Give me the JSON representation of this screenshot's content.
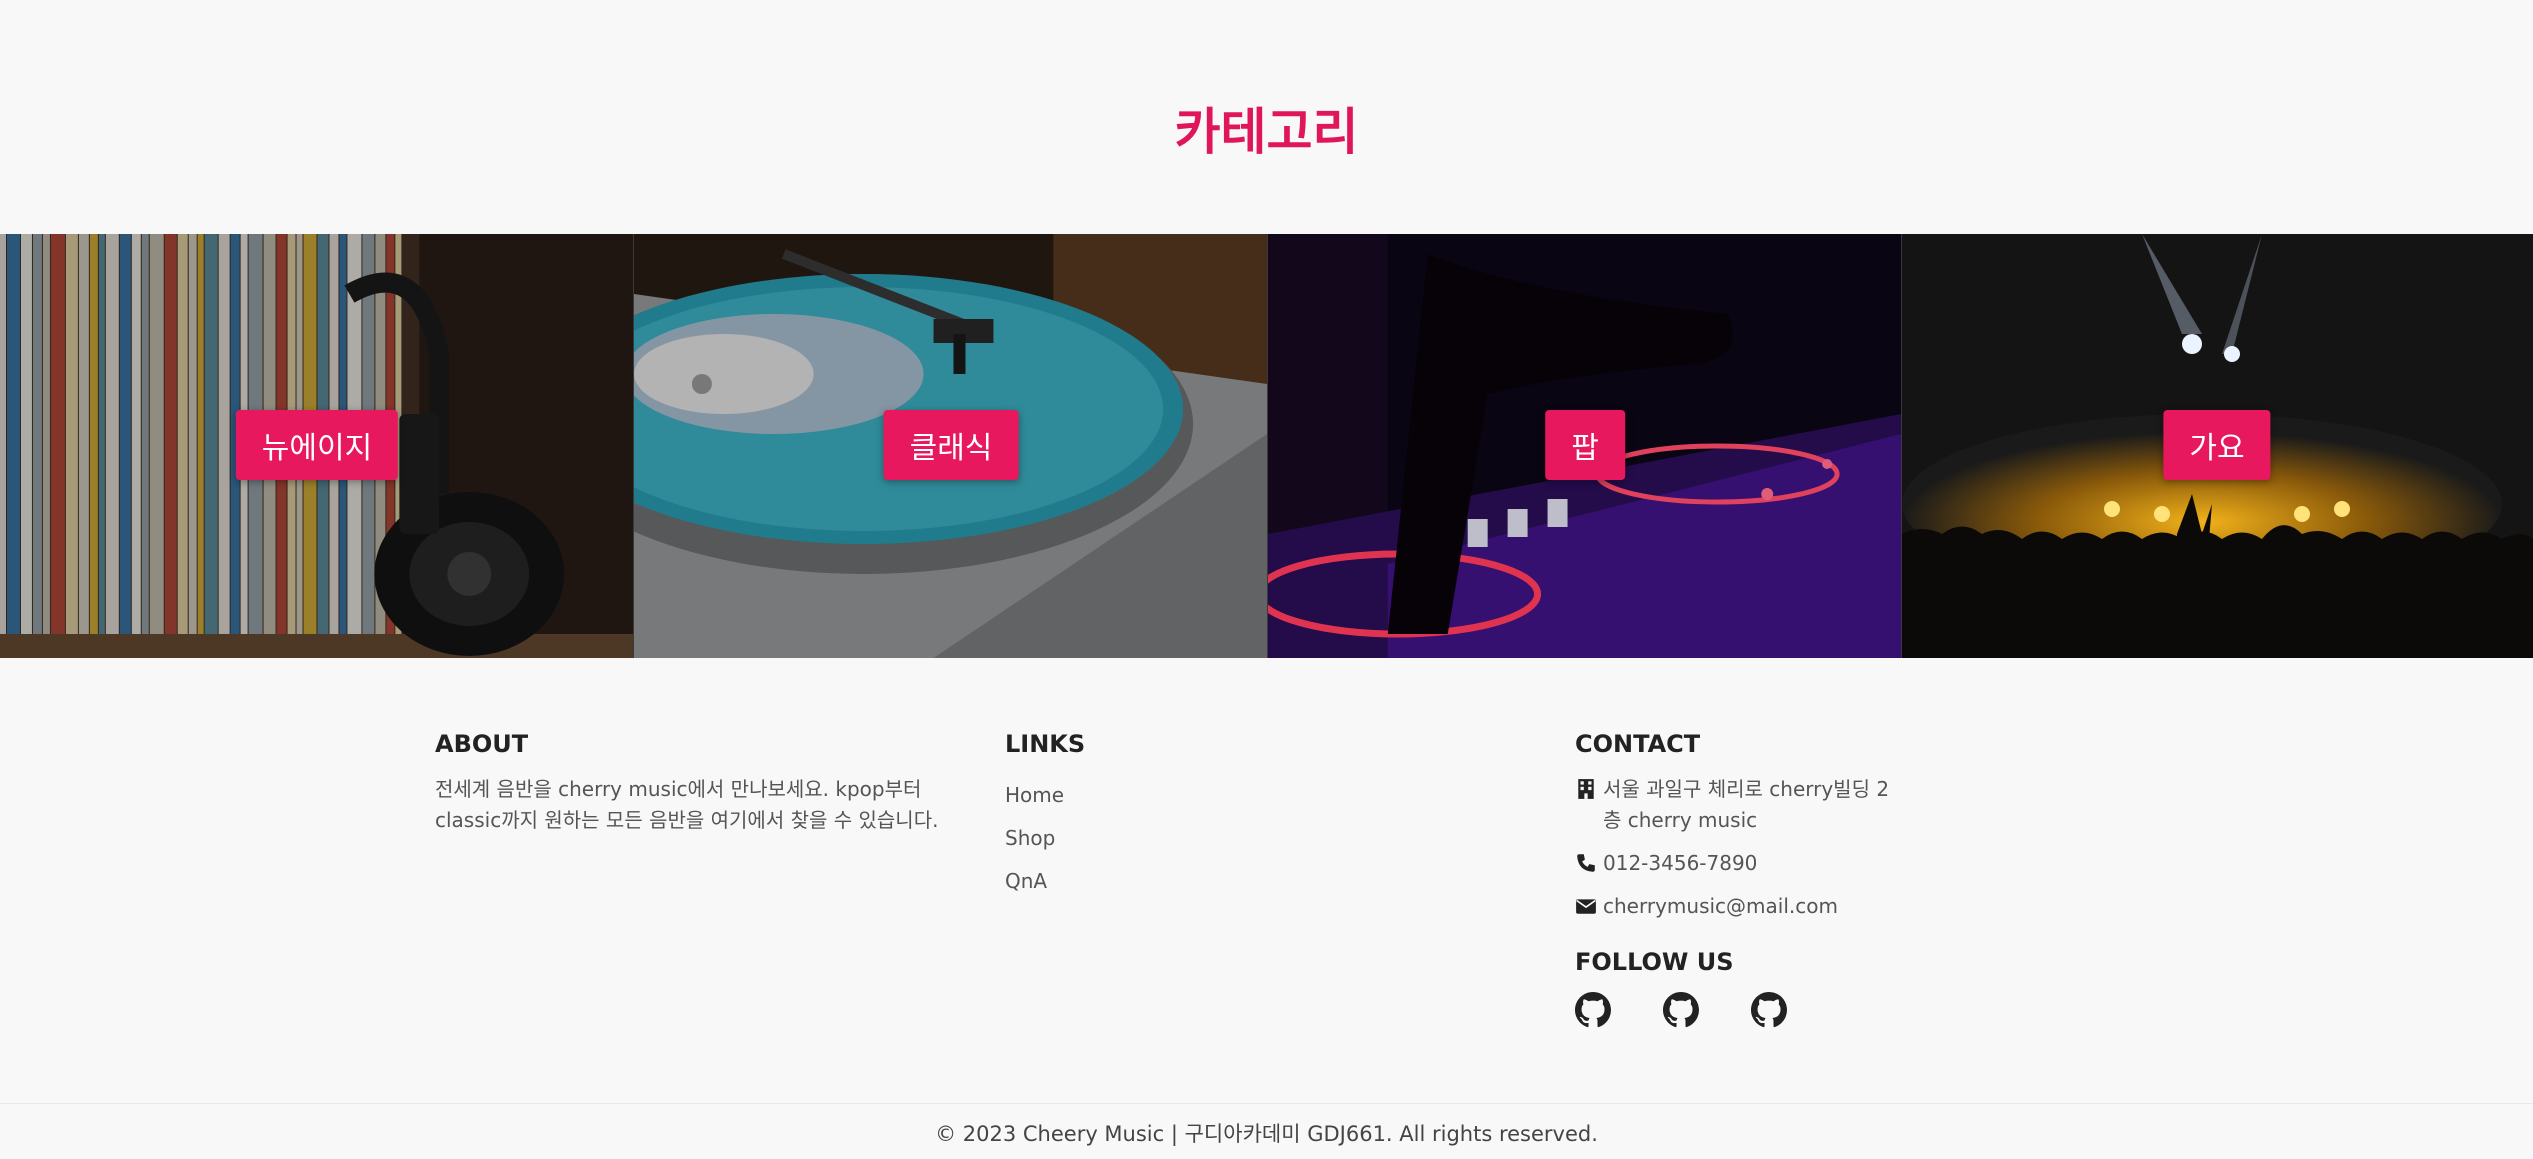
{
  "section": {
    "title": "카테고리"
  },
  "categories": [
    {
      "label": "뉴에이지",
      "art": "vinyl-records-headphones"
    },
    {
      "label": "클래식",
      "art": "turntable"
    },
    {
      "label": "팝",
      "art": "dj-controller"
    },
    {
      "label": "가요",
      "art": "concert-crowd"
    }
  ],
  "footer": {
    "about": {
      "title": "ABOUT",
      "text": "전세계 음반을 cherry music에서 만나보세요. kpop부터 classic까지 원하는 모든 음반을 여기에서 찾을 수 있습니다."
    },
    "links": {
      "title": "LINKS",
      "items": [
        "Home",
        "Shop",
        "QnA"
      ]
    },
    "contact": {
      "title": "CONTACT",
      "address": "서울 과일구 체리로 cherry빌딩 2층 cherry music",
      "phone": "012-3456-7890",
      "email": "cherrymusic@mail.com",
      "icons": [
        "building-icon",
        "phone-icon",
        "envelope-icon"
      ]
    },
    "follow": {
      "title": "FOLLOW US",
      "icons": [
        "github-icon",
        "github-icon",
        "github-icon"
      ]
    },
    "copyright": "© 2023 Cheery Music | 구디아카데미 GDJ661. All rights reserved."
  },
  "colors": {
    "accent": "#e8185e",
    "title": "#e0165b",
    "background": "#f8f8f8"
  }
}
